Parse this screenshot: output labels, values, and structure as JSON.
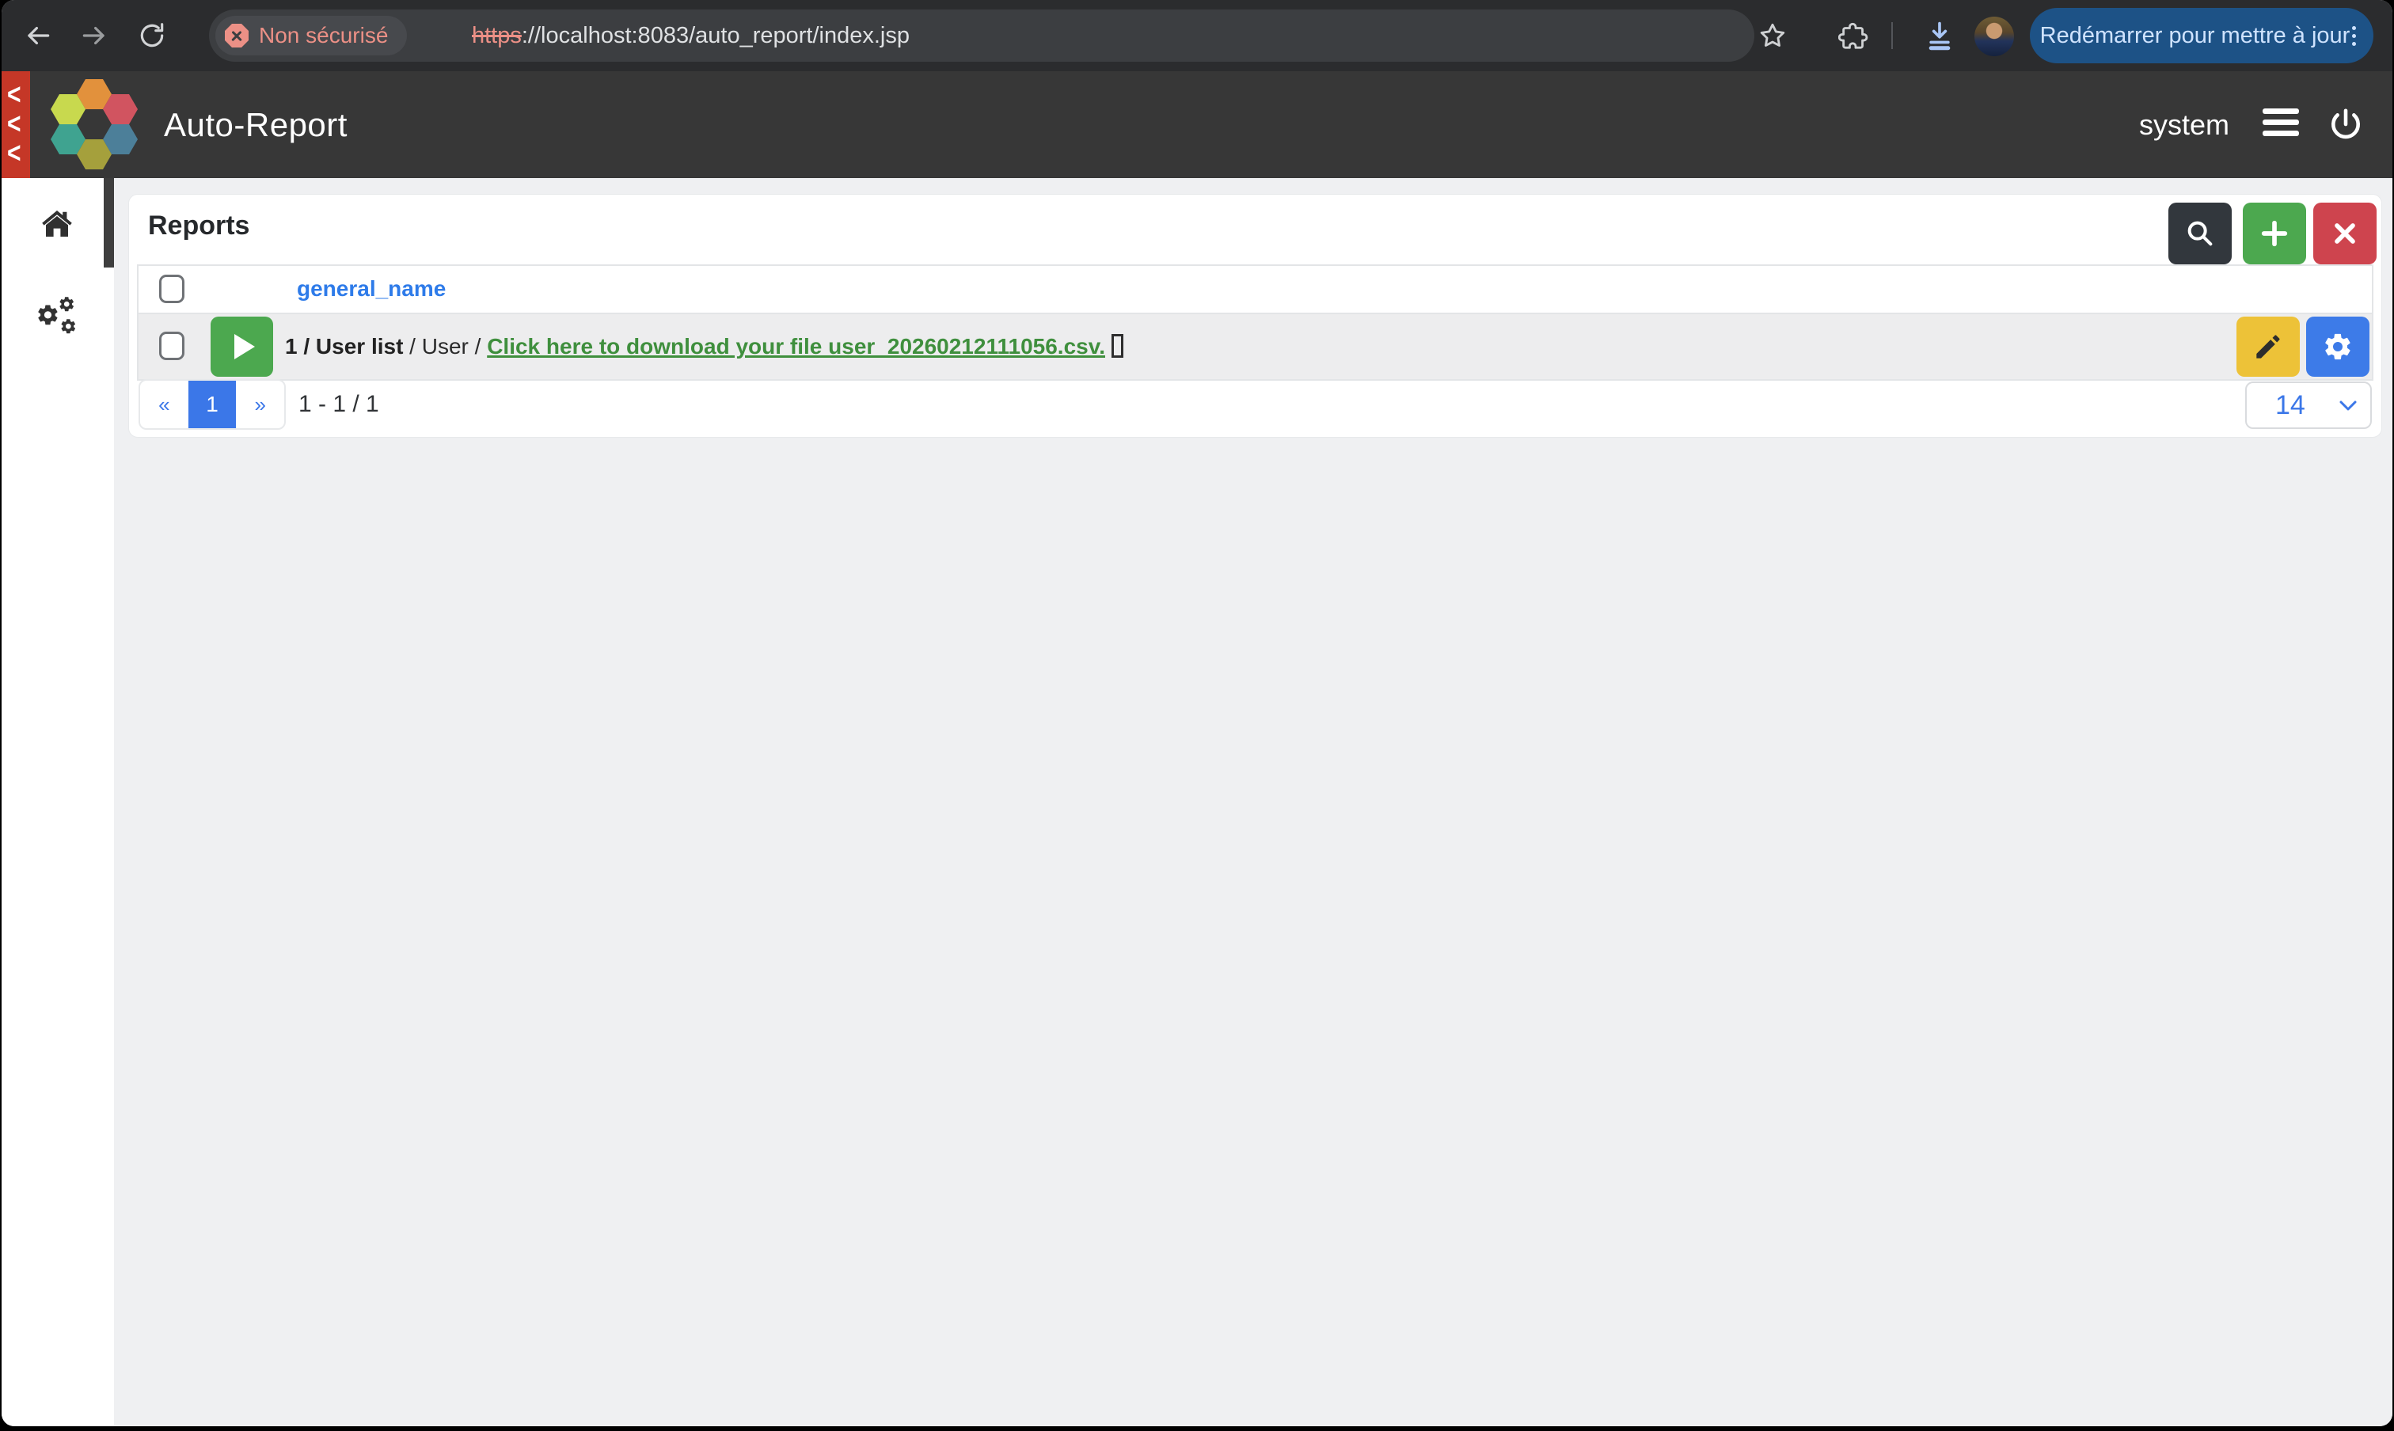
{
  "browser": {
    "security_chip_label": "Non sécurisé",
    "url_scheme": "https",
    "url_rest": "://localhost:8083/auto_report/index.jsp",
    "restart_button_label": "Redémarrer pour mettre à jour"
  },
  "header": {
    "app_title": "Auto-Report",
    "user_label": "system"
  },
  "reports": {
    "title": "Reports",
    "table": {
      "column_header": "general_name",
      "row": {
        "bold_text": "1 / User list",
        "mid_text": " / User / ",
        "link_text": "Click here to download your file user_20260212111056.csv."
      }
    },
    "pagination": {
      "prev_label": "«",
      "page_label": "1",
      "next_label": "»",
      "range_label": "1 - 1 / 1",
      "page_size_value": "14"
    }
  },
  "colors": {
    "accent_blue": "#3B77E8",
    "success_green": "#4CA84F",
    "danger_red": "#CE444E",
    "warning_amber": "#EDC238",
    "link_green": "#3F8F3D",
    "header_link_blue": "#2E7BE9",
    "chrome_error_salmon": "#EC9086"
  }
}
